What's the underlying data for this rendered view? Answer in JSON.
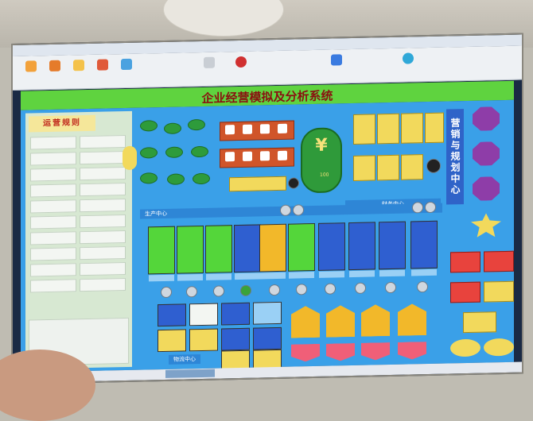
{
  "app": {
    "title": "企业经营模拟及分析系统",
    "window_caption": "",
    "taskbar_item": ""
  },
  "left_panel": {
    "title": "运营规则"
  },
  "right_panel": {
    "title": "营销与规划中心"
  },
  "finance": {
    "title": "财务中心",
    "cash_value": "100"
  },
  "production": {
    "title": "生产中心"
  },
  "logistics": {
    "title": "物流中心"
  },
  "colors": {
    "header_green": "#5fd33f",
    "panel_blue": "#3aa0e8",
    "title_red": "#8a1010",
    "machine_green": "#54d63a",
    "machine_yellow": "#f2b82a",
    "machine_blue": "#2f5fd0"
  },
  "icons": {
    "cash": "yuan-icon",
    "market": "gem-icon",
    "plan": "star-icon"
  }
}
